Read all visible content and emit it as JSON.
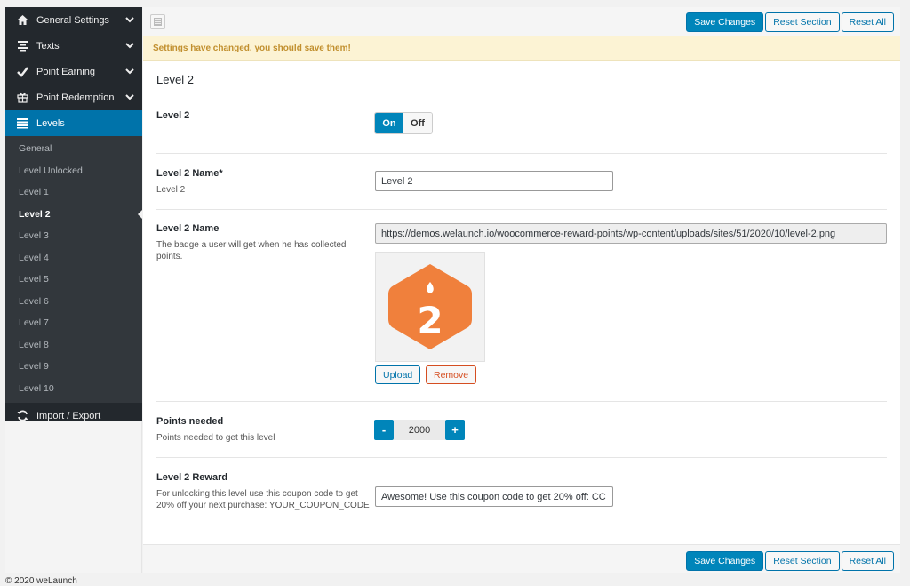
{
  "sidebar": {
    "items": [
      {
        "label": "General Settings",
        "icon": "home-icon"
      },
      {
        "label": "Texts",
        "icon": "text-align-icon"
      },
      {
        "label": "Point Earning",
        "icon": "checkmark-icon"
      },
      {
        "label": "Point Redemption",
        "icon": "gift-icon"
      },
      {
        "label": "Levels",
        "icon": "list-icon"
      },
      {
        "label": "Import / Export",
        "icon": "refresh-icon"
      }
    ],
    "sub_items": [
      "General",
      "Level Unlocked",
      "Level 1",
      "Level 2",
      "Level 3",
      "Level 4",
      "Level 5",
      "Level 6",
      "Level 7",
      "Level 8",
      "Level 9",
      "Level 10"
    ],
    "current_sub": "Level 2"
  },
  "toolbar": {
    "save_label": "Save Changes",
    "reset_section_label": "Reset Section",
    "reset_all_label": "Reset All"
  },
  "notice": "Settings have changed, you should save them!",
  "section": {
    "title": "Level 2",
    "fields": {
      "enable": {
        "title": "Level 2",
        "on_label": "On",
        "off_label": "Off",
        "value": "On"
      },
      "name": {
        "title": "Level 2 Name*",
        "desc": "Level 2",
        "value": "Level 2"
      },
      "badge": {
        "title": "Level 2 Name",
        "desc": "The badge a user will get when he has collected points.",
        "url": "https://demos.welaunch.io/woocommerce-reward-points/wp-content/uploads/sites/51/2020/10/level-2.png",
        "badge_number": "2",
        "upload_label": "Upload",
        "remove_label": "Remove"
      },
      "points": {
        "title": "Points needed",
        "desc": "Points needed to get this level",
        "value": "2000",
        "minus": "-",
        "plus": "+"
      },
      "reward": {
        "title": "Level 2 Reward",
        "desc": "For unlocking this level use this coupon code to get 20% off your next purchase: YOUR_COUPON_CODE",
        "value": "Awesome! Use this coupon code to get 20% off: CC"
      }
    }
  },
  "footer": "© 2020 weLaunch",
  "colors": {
    "accent": "#0085ba",
    "sidebar_bg": "#23282d",
    "badge_orange": "#f0803c",
    "notice_text": "#c18f2e"
  }
}
